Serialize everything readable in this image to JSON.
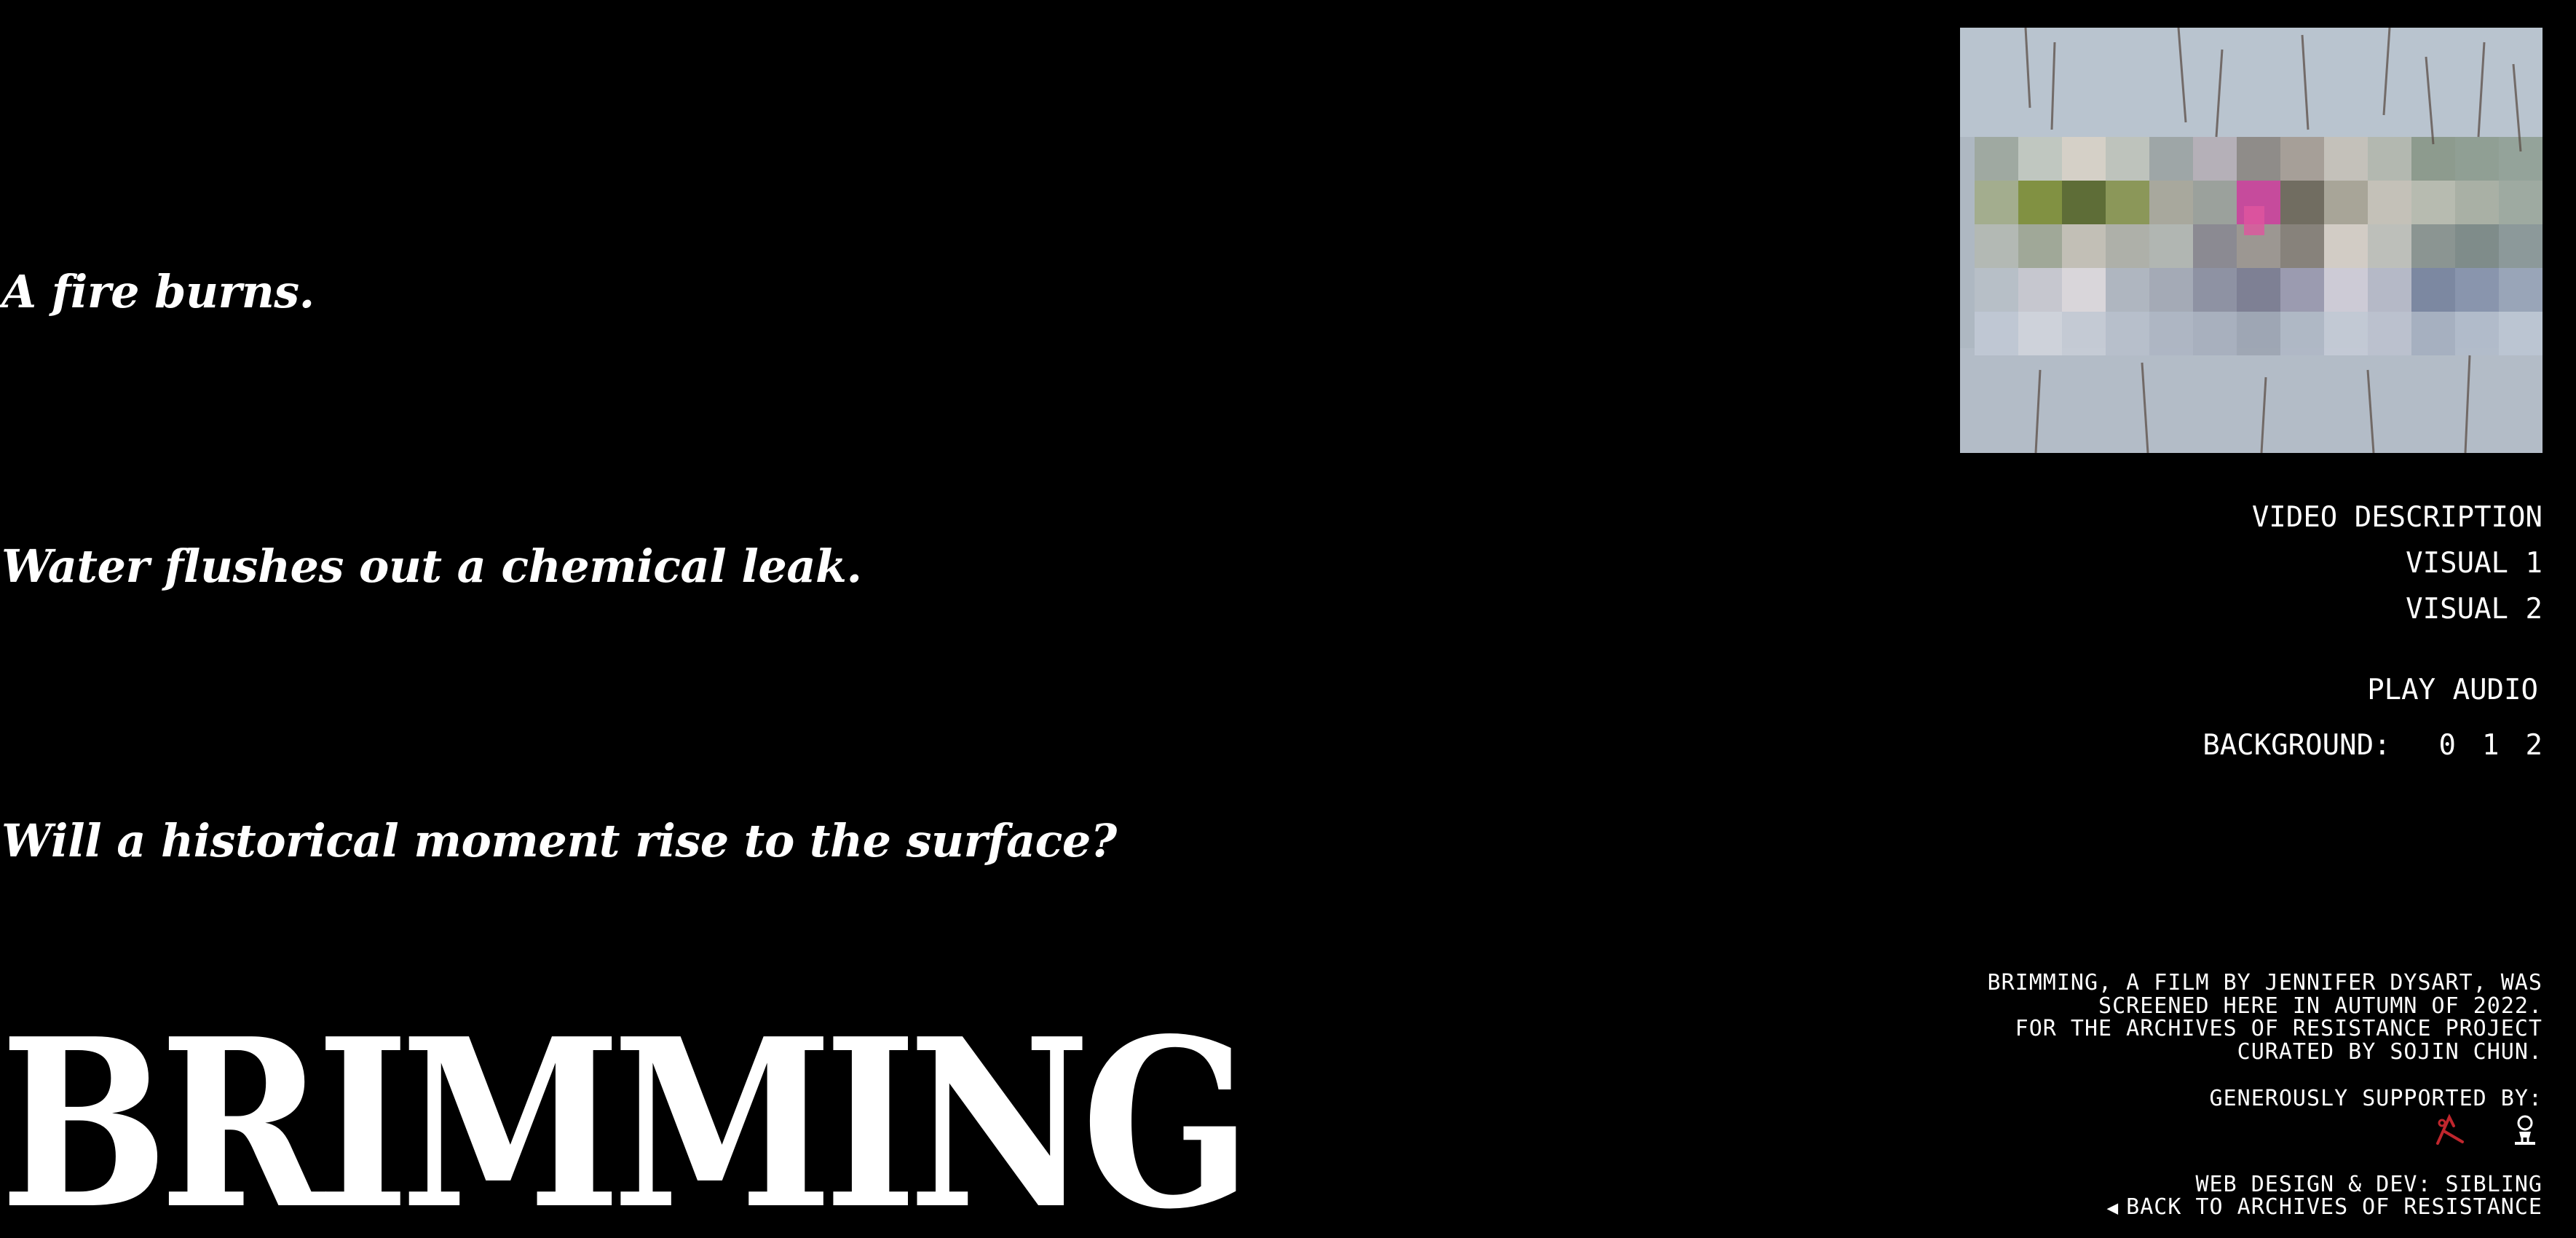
{
  "lines": [
    "A fire burns.",
    "Water flushes out a chemical leak.",
    "Will a historical moment rise to the surface?"
  ],
  "title": "BRIMMING",
  "menu": {
    "video_description": "VIDEO DESCRIPTION",
    "visual_1": "VISUAL 1",
    "visual_2": "VISUAL 2",
    "play_audio": "PLAY AUDIO"
  },
  "background": {
    "label": "BACKGROUND:",
    "options": [
      "0",
      "1",
      "2"
    ]
  },
  "credits": {
    "lines": [
      "BRIMMING, A FILM BY JENNIFER DYSART, WAS",
      "SCREENED HERE IN AUTUMN OF 2022.",
      "FOR THE ARCHIVES OF RESISTANCE PROJECT",
      "CURATED BY SOJIN CHUN."
    ],
    "supported_by": "GENEROUSLY SUPPORTED BY:",
    "web_design": "WEB DESIGN & DEV: SIBLING",
    "back_link": "BACK TO ARCHIVES OF RESISTANCE"
  },
  "icons": {
    "back_arrow": "arrow-left-icon",
    "sponsor_1": "sponsor-logo-red",
    "sponsor_2": "sponsor-logo-white"
  },
  "colors": {
    "background": "#000000",
    "text": "#ffffff",
    "sponsor_red": "#c0262d"
  }
}
